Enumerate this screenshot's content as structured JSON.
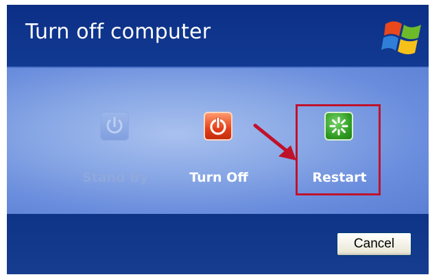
{
  "dialog": {
    "title": "Turn off computer",
    "logo_icon": "windows-logo-icon"
  },
  "options": [
    {
      "label": "Stand By",
      "icon": "power-icon",
      "state": "disabled"
    },
    {
      "label": "Turn Off",
      "icon": "power-button-icon",
      "state": "enabled"
    },
    {
      "label": "Restart",
      "icon": "restart-icon",
      "state": "enabled",
      "highlighted": true
    }
  ],
  "buttons": {
    "cancel_label": "Cancel"
  },
  "colors": {
    "title_bar": "#123a92",
    "content_light": "#a9c1ef",
    "content_dark": "#5b7fd3",
    "highlight_box": "#c0112a",
    "turn_off_icon": "#e2401a",
    "restart_icon": "#2f9a22"
  }
}
